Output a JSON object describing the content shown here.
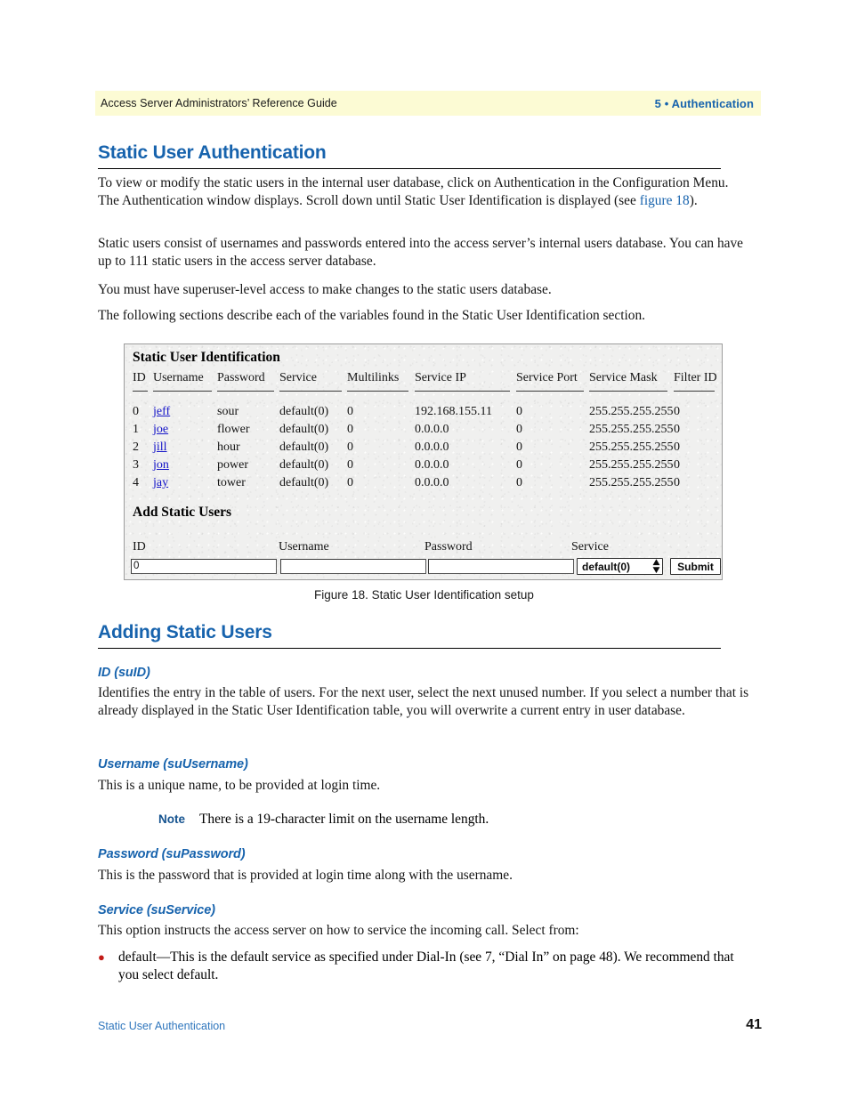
{
  "header": {
    "left": "Access Server Administrators’ Reference Guide",
    "right": "5 • Authentication",
    "bg_color": "#fcfbd4",
    "accent_color": "#1763ad"
  },
  "sections": {
    "title": "Static User Authentication",
    "para1_a": "To view or modify the static users in the internal user database, click on Authentication in the Configuration Menu. The Authentication window displays. Scroll down until Static User Identification is displayed (see ",
    "para1_link": "figure 18",
    "para1_b": ").",
    "para2": "Static users consist of usernames and passwords entered into the access server’s internal users database. You can have up to 111 static users in the access server database.",
    "para3": "You must have superuser-level access to make changes to the static users database.",
    "para4": "The following sections describe each of the variables found in the Static User Identification section.",
    "caption": "Figure 18. Static User Identification setup",
    "adding_title": "Adding Static Users",
    "id_heading": "ID (suID)",
    "id_body": "Identifies the entry in the table of users. For the next user, select the next unused number. If you select a number that is already displayed in the Static User Identification table, you will overwrite a current entry in user database.",
    "username_heading": "Username (suUsername)",
    "username_body": "This is a unique name, to be provided at login time.",
    "note_label": "Note",
    "note_body": "There is a 19-character limit on the username length.",
    "password_heading": "Password (suPassword)",
    "password_body": "This is the password that is provided at login time along with the username.",
    "service_heading": "Service (suService)",
    "service_body": "This option instructs the access server on how to service the incoming call. Select from:",
    "bullet1_a": "default—This is the default service as specified under Dial-In (see 7, ",
    "bullet1_link": "“Dial In”",
    "bullet1_b": " on page 48). We recommend that you select default."
  },
  "figure": {
    "panel_title": "Static User Identification",
    "add_title": "Add Static Users",
    "columns": [
      "ID",
      "Username",
      "Password",
      "Service",
      "Multilinks",
      "Service IP",
      "Service Port",
      "Service Mask",
      "Filter ID"
    ],
    "rows": [
      {
        "id": "0",
        "username": "jeff",
        "password": "sour",
        "service": "default(0)",
        "multilinks": "0",
        "service_ip": "192.168.155.11",
        "service_port": "0",
        "service_mask": "255.255.255.255",
        "filter_id": "0"
      },
      {
        "id": "1",
        "username": "joe",
        "password": "flower",
        "service": "default(0)",
        "multilinks": "0",
        "service_ip": "0.0.0.0",
        "service_port": "0",
        "service_mask": "255.255.255.255",
        "filter_id": "0"
      },
      {
        "id": "2",
        "username": "jill",
        "password": "hour",
        "service": "default(0)",
        "multilinks": "0",
        "service_ip": "0.0.0.0",
        "service_port": "0",
        "service_mask": "255.255.255.255",
        "filter_id": "0"
      },
      {
        "id": "3",
        "username": "jon",
        "password": "power",
        "service": "default(0)",
        "multilinks": "0",
        "service_ip": "0.0.0.0",
        "service_port": "0",
        "service_mask": "255.255.255.255",
        "filter_id": "0"
      },
      {
        "id": "4",
        "username": "jay",
        "password": "tower",
        "service": "default(0)",
        "multilinks": "0",
        "service_ip": "0.0.0.0",
        "service_port": "0",
        "service_mask": "255.255.255.255",
        "filter_id": "0"
      }
    ],
    "form": {
      "id_label": "ID",
      "id_value": "0",
      "username_label": "Username",
      "username_value": "",
      "password_label": "Password",
      "password_value": "",
      "service_label": "Service",
      "service_value": "default(0)",
      "submit_label": "Submit"
    }
  },
  "footer": {
    "left": "Static User Authentication",
    "page_number": "41"
  }
}
